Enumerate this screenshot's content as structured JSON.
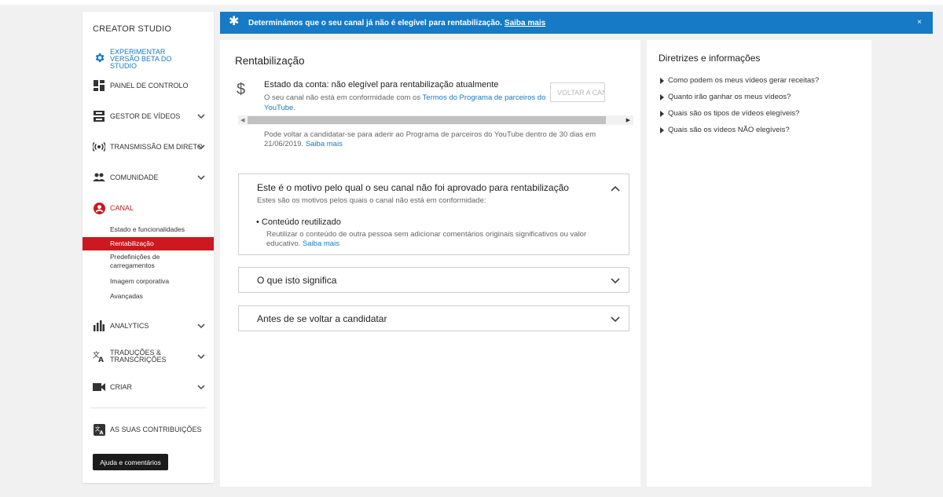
{
  "sidebar": {
    "title": "CREATOR STUDIO",
    "beta_label": "EXPERIMENTAR VERSÃO BETA DO STUDIO",
    "items": [
      {
        "label": "PAINEL DE CONTROLO",
        "icon": "dashboard-icon"
      },
      {
        "label": "GESTOR DE VÍDEOS",
        "icon": "video-manager-icon"
      },
      {
        "label": "TRANSMISSÃO EM DIRETO",
        "icon": "live-icon"
      },
      {
        "label": "COMUNIDADE",
        "icon": "community-icon"
      },
      {
        "label": "CANAL",
        "icon": "channel-icon"
      },
      {
        "label": "ANALYTICS",
        "icon": "analytics-icon"
      },
      {
        "label": "TRADUÇÕES & TRANSCRIÇÕES",
        "icon": "translate-icon"
      },
      {
        "label": "CRIAR",
        "icon": "create-icon"
      }
    ],
    "channel_subitems": [
      "Estado e funcionalidades",
      "Rentabilização",
      "Predefinições de carregamentos",
      "Imagem corporativa",
      "Avançadas"
    ],
    "contributions_label": "AS SUAS CONTRIBUIÇÕES",
    "help_button": "Ajuda e comentários"
  },
  "banner": {
    "text": "Determinámos que o seu canal já não é elegível para rentabilização.",
    "link": "Saiba mais",
    "close": "×",
    "color": "#167ac6"
  },
  "main": {
    "title": "Rentabilização",
    "account_status": "Estado da conta: não elegível para rentabilização atualmente",
    "account_desc": "O seu canal não está em conformidade com os",
    "account_desc_link": "Termos do Programa de parceiros do YouTube",
    "account_desc_end": ".",
    "reapply_button": "VOLTAR A CANDIDATAR",
    "reapply_note": "Pode voltar a candidatar-se para aderir ao Programa de parceiros do YouTube dentro de 30 dias em 21/06/2019.",
    "reapply_note_link": "Saiba mais",
    "accordions": [
      {
        "title": "Este é o motivo pelo qual o seu canal não foi aprovado para rentabilização",
        "subtitle": "Estes são os motivos pelos quais o canal não está em conformidade:",
        "bullet_title": "Conteúdo reutilizado",
        "bullet_desc": "Reutilizar o conteúdo de outra pessoa sem adicionar comentários originais significativos ou valor educativo.",
        "bullet_link": "Saiba mais"
      },
      {
        "title": "O que isto significa"
      },
      {
        "title": "Antes de se voltar a candidatar"
      }
    ]
  },
  "right": {
    "title": "Diretrizes e informações",
    "links": [
      "Como podem os meus vídeos gerar receitas?",
      "Quanto irão ganhar os meus vídeos?",
      "Quais são os tipos de vídeos elegíveis?",
      "Quais são os vídeos NÃO elegíveis?"
    ]
  },
  "colors": {
    "accent_red": "#cc181e",
    "link_blue": "#167ac6"
  }
}
